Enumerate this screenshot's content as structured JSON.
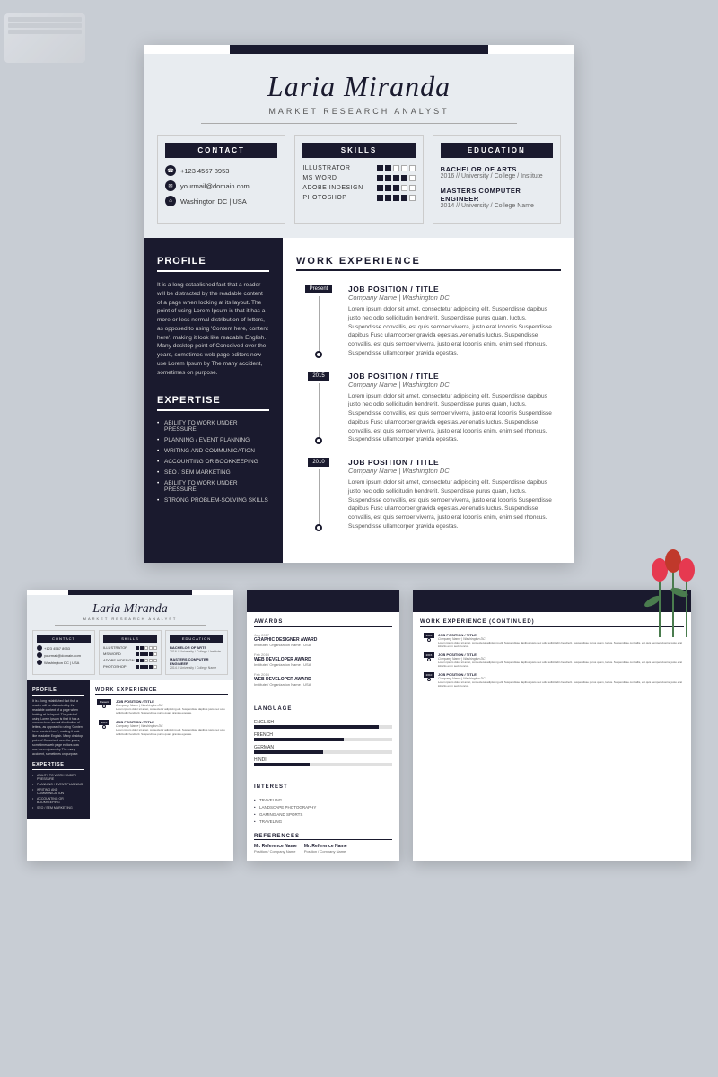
{
  "page": {
    "bg_color": "#c8cdd4"
  },
  "resume": {
    "name": "Laria Miranda",
    "title": "MARKET RESEARCH ANALYST",
    "contact": {
      "header": "CONTACT",
      "phone": "+123 4567 8953",
      "email": "yourmail@domain.com",
      "location": "Washington DC | USA"
    },
    "skills": {
      "header": "SKILLS",
      "items": [
        {
          "name": "ILLUSTRATOR",
          "filled": 2,
          "empty": 3
        },
        {
          "name": "MS WORD",
          "filled": 4,
          "empty": 1
        },
        {
          "name": "ADOBE INDESIGN",
          "filled": 3,
          "empty": 2
        },
        {
          "name": "PHOTOSHOP",
          "filled": 4,
          "empty": 1
        }
      ]
    },
    "education": {
      "header": "EDUCATION",
      "items": [
        {
          "degree": "BACHELOR OF ARTS",
          "year": "2016 // University / College / Institute"
        },
        {
          "degree": "MASTERS COMPUTER ENGINEER",
          "year": "2014 // University / College Name"
        }
      ]
    },
    "profile": {
      "title": "PROFILE",
      "text": "It is a long established fact that a reader will be distracted by the readable content of a page when looking at its layout. The point of using Lorem Ipsum is that it has a more-or-less normal distribution of letters, as opposed to using 'Content here, content here', making it look like readable English. Many desktop point of Conceived over the years, sometimes web page editors now use Lorem Ipsum by The many accident, sometimes on purpose."
    },
    "expertise": {
      "title": "EXPERTISE",
      "items": [
        "ABILITY TO WORK UNDER PRESSURE",
        "PLANNING / EVENT PLANNING",
        "WRITING AND COMMUNICATION",
        "ACCOUNTING OR BOOKKEEPING",
        "SEO / SEM MARKETING",
        "ABILITY TO WORK UNDER PRESSURE",
        "STRONG PROBLEM-SOLVING SKILLS"
      ]
    },
    "work_experience": {
      "title": "WORK EXPERIENCE",
      "items": [
        {
          "badge": "Present",
          "job_title": "JOB POSITION / TITLE",
          "company": "Company Name | Washington DC",
          "description": "Lorem ipsum dolor sit amet, consectetur adipiscing elit. Suspendisse dapibus justo nec odio sollicitudin hendrerit. Suspendisse purus quam, luctus. Suspendisse convallis, est quis semper viverra, justo erat lobortis Suspendisse dapibus Fusc ullamcorper gravida egestas.venenatis luctus. Suspendisse convallis, est quis semper viverra, justo erat lobortis enim, enim sed rhoncus. Suspendisse ullamcorper gravida egestas."
        },
        {
          "badge": "2015",
          "job_title": "JOB POSITION / TITLE",
          "company": "Company Name | Washington DC",
          "description": "Lorem ipsum dolor sit amet, consectetur adipiscing elit. Suspendisse dapibus justo nec odio sollicitudin hendrerit. Suspendisse purus quam, luctus. Suspendisse convallis, est quis semper viverra, justo erat lobortis Suspendisse dapibus Fusc ullamcorper gravida egestas.venenatis luctus. Suspendisse convallis, est quis semper viverra, justo erat lobortis enim, enim sed rhoncus. Suspendisse ullamcorper gravida egestas."
        },
        {
          "badge": "2010",
          "job_title": "JOB POSITION / TITLE",
          "company": "Company Name | Washington DC",
          "description": "Lorem ipsum dolor sit amet, consectetur adipiscing elit. Suspendisse dapibus justo nec odio sollicitudin hendrerit. Suspendisse purus quam, luctus. Suspendisse convallis, est quis semper viverra, justo erat lobortis Suspendisse dapibus Fusc ullamcorper gravida egestas.venenatis luctus. Suspendisse convallis, est quis semper viverra, justo erat lobortis enim, enim sed rhoncus. Suspendisse ullamcorper gravida egestas."
        }
      ]
    }
  },
  "page2": {
    "awards": {
      "title": "AWARDS",
      "items": [
        {
          "date": "July 2017",
          "title": "GRAPHIC DESIGNER AWARD",
          "org": "Institute / Organization Name / USA"
        },
        {
          "date": "Feb 2014",
          "title": "WEB DEVELOPER AWARD",
          "org": "Institute / Organization Name / USA"
        },
        {
          "date": "Feb 2014",
          "title": "WEB DEVELOPER AWARD",
          "org": "Institute / Organization Name / USA"
        }
      ]
    },
    "language": {
      "title": "LANGUAGE",
      "items": [
        {
          "name": "ENGLISH",
          "pct": 90
        },
        {
          "name": "FRENCH",
          "pct": 65
        },
        {
          "name": "GERMAN",
          "pct": 50
        },
        {
          "name": "HINDI",
          "pct": 40
        }
      ]
    },
    "interest": {
      "title": "INTEREST",
      "items": [
        "TRAVELING",
        "LANDSCAPE PHOTOGRAPHY",
        "GAMING AND SPORTS",
        "TRAVELING"
      ]
    },
    "references": {
      "title": "REFERENCES",
      "items": [
        {
          "name": "Mr. Reference Name",
          "detail": ""
        },
        {
          "name": "Mr. Reference Name",
          "detail": ""
        }
      ]
    },
    "work_continued": {
      "title": "WORK EXPERIENCE (CONTINUED)",
      "items": [
        {
          "badge": "2016",
          "job": "JOB POSITION / TITLE",
          "company": "Company Name | Washington DC",
          "desc": "Lorem ipsum dolor sit amet, consectetur adipiscing elit. Suspendisse dapibus justo nec odio sollicitudin hendrerit. Suspendisse purus quam, luctus. Suspendisse convallis, est quis semper viverra, justo erat lobortis."
        },
        {
          "badge": "2015",
          "job": "JOB POSITION / TITLE",
          "company": "Company Name | Washington DC",
          "desc": "Lorem ipsum dolor sit amet, consectetur adipiscing elit. Suspendisse dapibus justo nec odio sollicitudin hendrerit. Suspendisse purus quam, luctus. Suspendisse convallis, est quis semper viverra, justo erat lobortis."
        },
        {
          "badge": "2010",
          "job": "JOB POSITION / TITLE",
          "company": "Company Name | Washington DC",
          "desc": "Lorem ipsum dolor sit amet, consectetur adipiscing elit. Suspendisse dapibus justo nec odio sollicitudin hendrerit. Suspendisse purus quam, luctus. Suspendisse convallis, est quis semper viverra, justo erat lobortis."
        }
      ]
    }
  }
}
